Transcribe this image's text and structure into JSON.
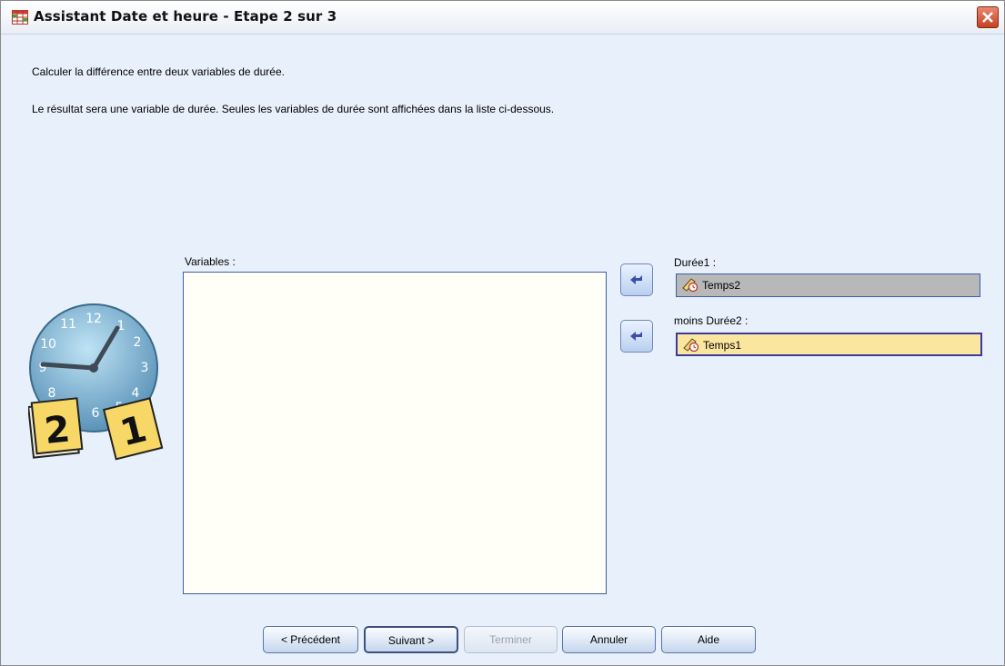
{
  "window": {
    "title": "Assistant Date et heure - Etape 2 sur 3"
  },
  "instructions": {
    "line1": "Calculer la différence entre deux variables de durée.",
    "line2": "Le résultat sera une variable de durée. Seules les variables de durée sont affichées dans la liste ci-dessous."
  },
  "variables": {
    "label": "Variables :",
    "items": []
  },
  "duree1": {
    "label": "Durée1 :",
    "value": "Temps2"
  },
  "duree2": {
    "label": "moins Durée2 :",
    "value": "Temps1"
  },
  "buttons": {
    "previous": "< Précédent",
    "next": "Suivant >",
    "finish": "Terminer",
    "cancel": "Annuler",
    "help": "Aide"
  },
  "colors": {
    "background": "#e8f1fb",
    "field_selected": "#fbe6a0",
    "field_gray": "#b8b8b8",
    "close": "#c9401f"
  },
  "icons": [
    "table-icon",
    "close-icon",
    "clock-calendar-icon",
    "arrow-left-icon",
    "duration-variable-icon"
  ]
}
